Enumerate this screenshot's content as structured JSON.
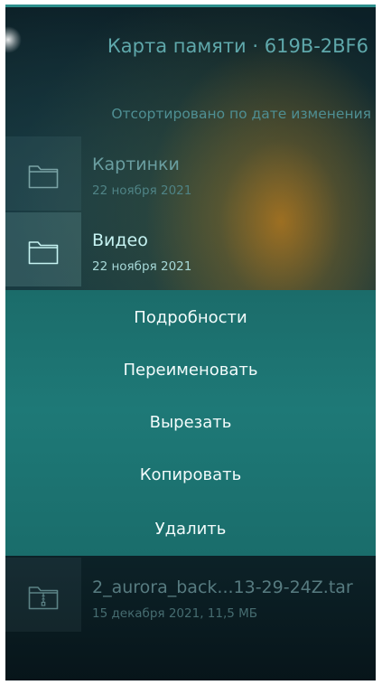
{
  "header": {
    "title": "Карта памяти · 619B-2BF6"
  },
  "sort_label": "Отсортировано по дате изменения",
  "items": [
    {
      "name": "Картинки",
      "details": "22 ноября 2021",
      "icon": "folder-icon"
    },
    {
      "name": "Видео",
      "details": "22 ноября 2021",
      "icon": "folder-icon"
    },
    {
      "name": "2_aurora_back...13-29-24Z.tar",
      "details": "15 декабря 2021, 11,5 МБ",
      "icon": "archive-icon"
    }
  ],
  "context_menu": {
    "items": [
      "Подробности",
      "Переименовать",
      "Вырезать",
      "Копировать",
      "Удалить"
    ]
  },
  "colors": {
    "accent": "#2c8f8c",
    "menu_background": "#1e7977",
    "highlight_text": "#c6f3f2"
  }
}
